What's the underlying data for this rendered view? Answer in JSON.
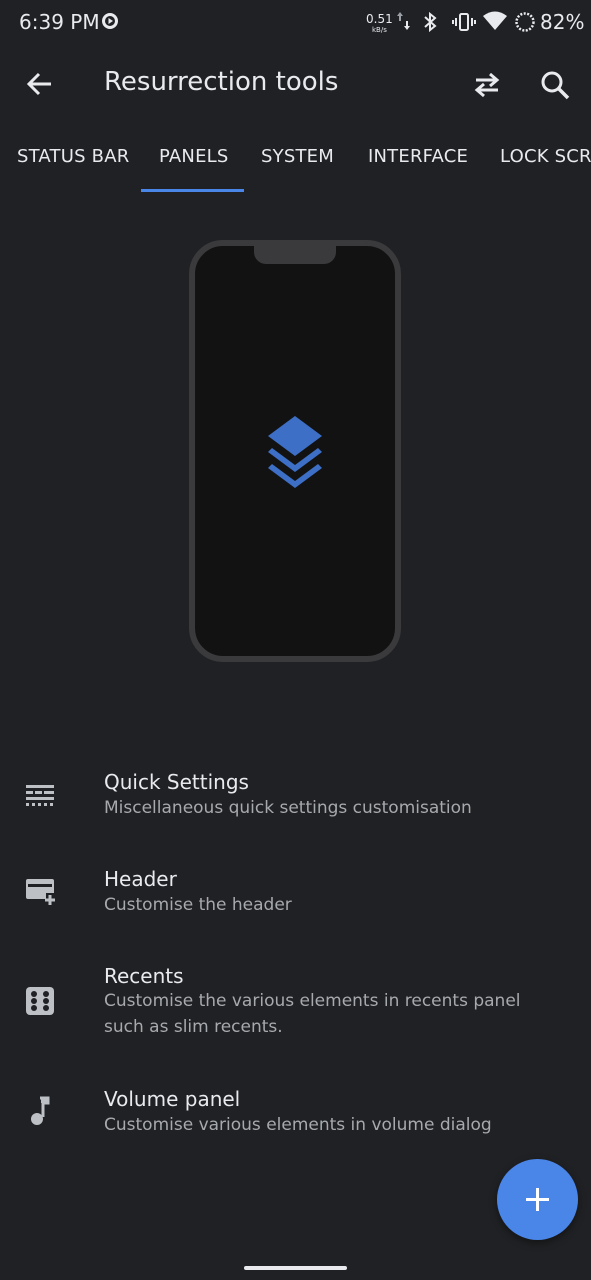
{
  "status_bar": {
    "time": "6:39 PM",
    "net_speed_value": "0.51",
    "net_speed_unit": "kB/s",
    "battery_percent": "82%"
  },
  "appbar": {
    "title": "Resurrection tools"
  },
  "tabs": [
    {
      "label": "STATUS BAR"
    },
    {
      "label": "PANELS"
    },
    {
      "label": "SYSTEM"
    },
    {
      "label": "INTERFACE"
    },
    {
      "label": "LOCK SCREEN"
    }
  ],
  "active_tab": "PANELS",
  "items": [
    {
      "title": "Quick Settings",
      "subtitle": "Miscellaneous quick settings customisation",
      "icon": "quick-settings-icon"
    },
    {
      "title": "Header",
      "subtitle": "Customise the header",
      "icon": "header-card-icon"
    },
    {
      "title": "Recents",
      "subtitle": "Customise the various elements in recents panel such as slim recents.",
      "icon": "recents-icon"
    },
    {
      "title": "Volume panel",
      "subtitle": "Customise various elements in volume dialog",
      "icon": "music-note-icon"
    }
  ],
  "colors": {
    "background": "#202124",
    "accent": "#4a86e8",
    "text_primary": "#e8eaed",
    "text_secondary": "#a6a9ad"
  }
}
